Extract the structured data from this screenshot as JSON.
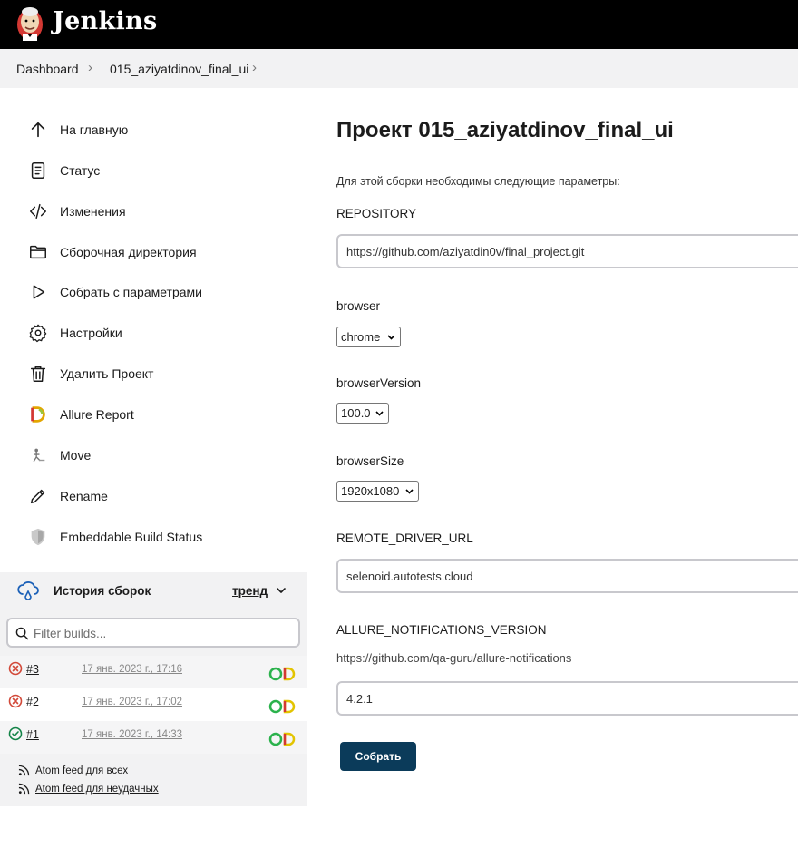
{
  "header": {
    "brand": "Jenkins"
  },
  "breadcrumb": {
    "items": [
      "Dashboard",
      "015_aziyatdinov_final_ui"
    ],
    "separator": "›"
  },
  "sidebar": {
    "tasks": [
      {
        "label": "На главную",
        "icon": "arrow-up-icon"
      },
      {
        "label": "Статус",
        "icon": "document-icon"
      },
      {
        "label": "Изменения",
        "icon": "code-icon"
      },
      {
        "label": "Сборочная директория",
        "icon": "folder-icon"
      },
      {
        "label": "Собрать с параметрами",
        "icon": "play-icon"
      },
      {
        "label": "Настройки",
        "icon": "gear-icon"
      },
      {
        "label": "Удалить Проект",
        "icon": "trash-icon"
      },
      {
        "label": "Allure Report",
        "icon": "allure-icon"
      },
      {
        "label": "Move",
        "icon": "move-icon"
      },
      {
        "label": "Rename",
        "icon": "pencil-icon"
      },
      {
        "label": "Embeddable Build Status",
        "icon": "shield-icon"
      }
    ]
  },
  "history": {
    "title": "История сборок",
    "trend_label": "тренд",
    "filter_placeholder": "Filter builds...",
    "builds": [
      {
        "number": "#3",
        "date": "17 янв. 2023 г., 17:16",
        "status": "failed"
      },
      {
        "number": "#2",
        "date": "17 янв. 2023 г., 17:02",
        "status": "failed"
      },
      {
        "number": "#1",
        "date": "17 янв. 2023 г., 14:33",
        "status": "success"
      }
    ],
    "feeds": {
      "all": "Atom feed для всех",
      "failed": "Atom feed для неудачных"
    }
  },
  "main": {
    "title": "Проект 015_aziyatdinov_final_ui",
    "description": "Для этой сборки необходимы следующие параметры:",
    "params": {
      "repository_label": "REPOSITORY",
      "repository_value": "https://github.com/aziyatdin0v/final_project.git",
      "browser_label": "browser",
      "browser_value": "chrome",
      "browser_version_label": "browserVersion",
      "browser_version_value": "100.0",
      "browser_size_label": "browserSize",
      "browser_size_value": "1920x1080",
      "remote_driver_label": "REMOTE_DRIVER_URL",
      "remote_driver_value": "selenoid.autotests.cloud",
      "allure_label": "ALLURE_NOTIFICATIONS_VERSION",
      "allure_description": "https://github.com/qa-guru/allure-notifications",
      "allure_value": "4.2.1"
    },
    "build_button": "Собрать"
  },
  "colors": {
    "header": "#000000",
    "button": "#0b3b5a",
    "failed": "#d24939",
    "success": "#138347"
  }
}
